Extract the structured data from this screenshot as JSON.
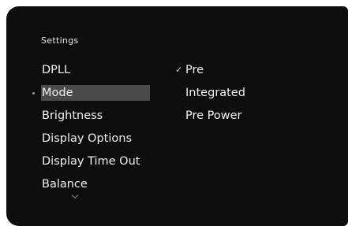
{
  "screen": {
    "title": "Settings"
  },
  "menu": {
    "items": [
      {
        "label": "DPLL"
      },
      {
        "label": "Mode",
        "selected": true
      },
      {
        "label": "Brightness"
      },
      {
        "label": "Display Options"
      },
      {
        "label": "Display Time Out"
      },
      {
        "label": "Balance"
      }
    ],
    "more_indicator": "chevron-down-icon"
  },
  "options": {
    "items": [
      {
        "label": "Pre",
        "checked": true
      },
      {
        "label": "Integrated"
      },
      {
        "label": "Pre Power"
      }
    ],
    "check_glyph": "✓"
  },
  "colors": {
    "background": "#0d0d0d",
    "highlight": "#4a4a4a",
    "text": "#f1f1f1"
  }
}
